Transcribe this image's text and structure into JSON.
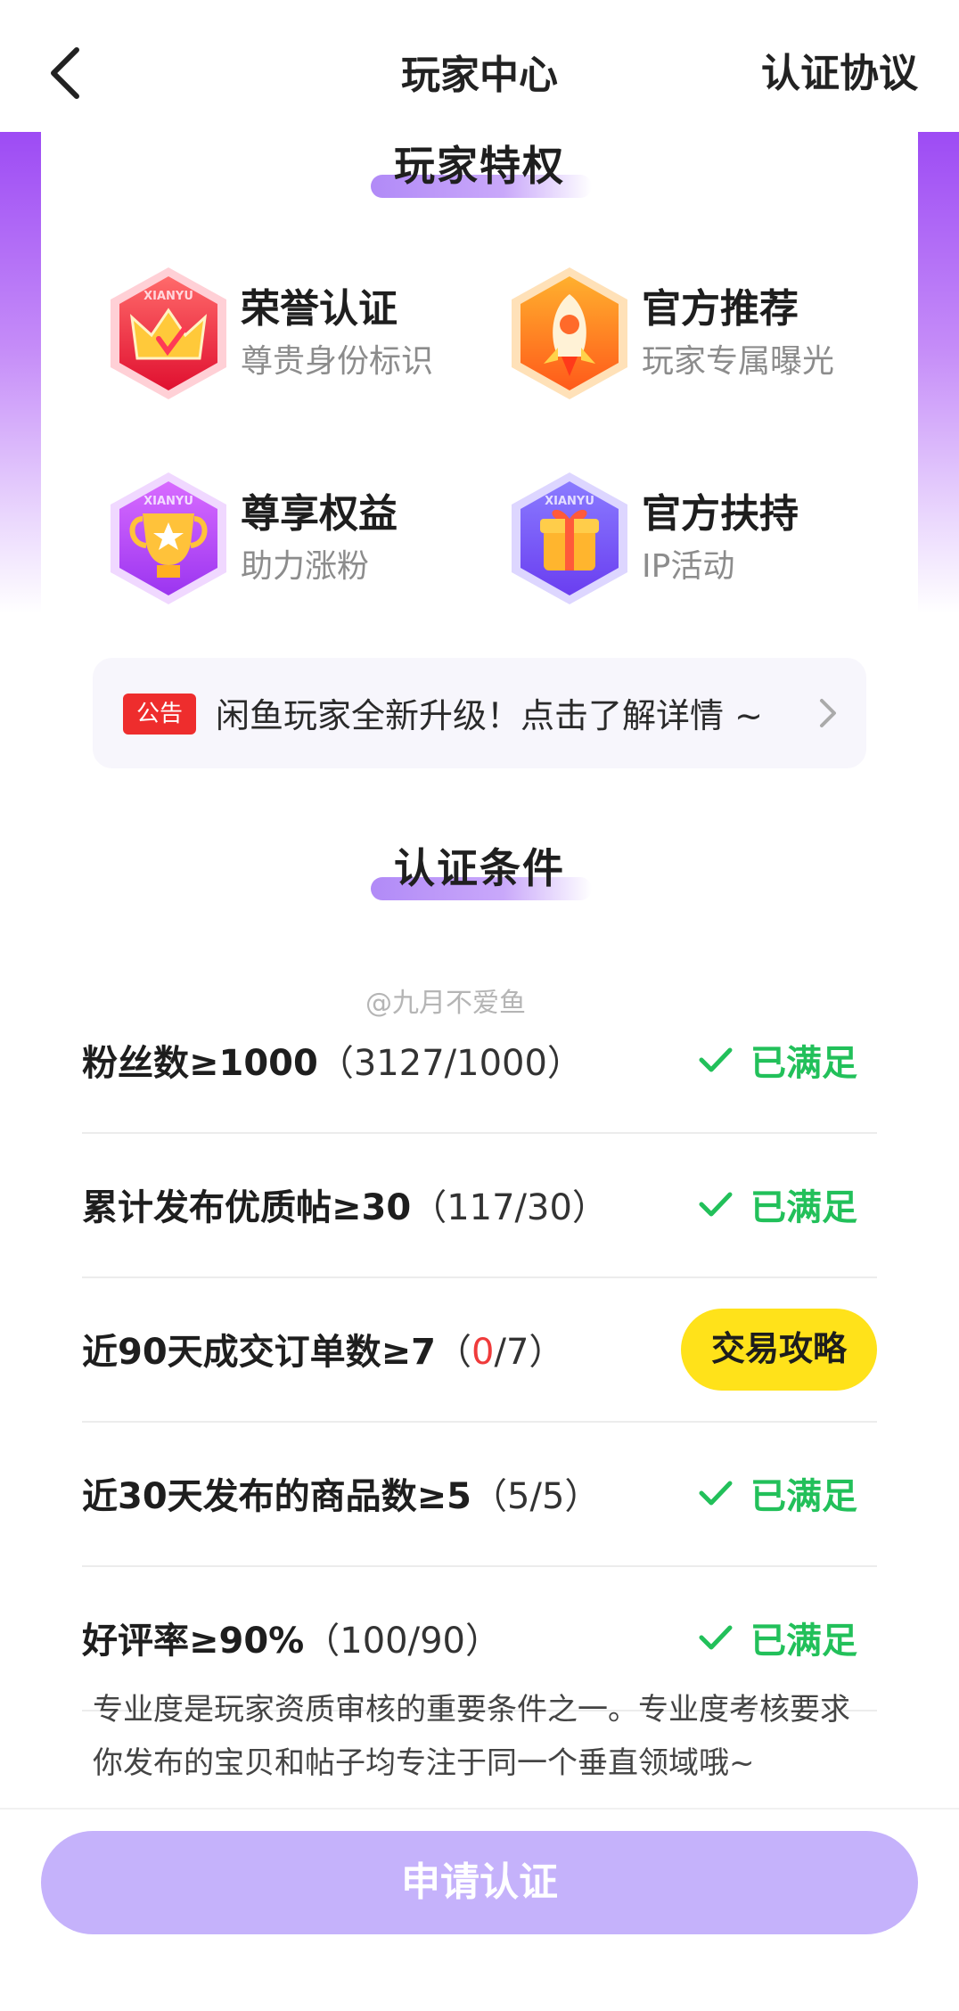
{
  "header": {
    "title": "玩家中心",
    "agreement_label": "认证协议"
  },
  "privileges": {
    "heading": "玩家特权",
    "items": [
      {
        "title": "荣誉认证",
        "subtitle": "尊贵身份标识",
        "icon": "crown-badge-icon"
      },
      {
        "title": "官方推荐",
        "subtitle": "玩家专属曝光",
        "icon": "rocket-badge-icon"
      },
      {
        "title": "尊享权益",
        "subtitle": "助力涨粉",
        "icon": "trophy-badge-icon"
      },
      {
        "title": "官方扶持",
        "subtitle": "IP活动",
        "icon": "gift-badge-icon"
      }
    ],
    "icon_badge_text": "XIANYU"
  },
  "notice": {
    "tag": "公告",
    "message": "闲鱼玩家全新升级！点击了解详情 ~"
  },
  "conditions": {
    "heading": "认证条件",
    "items": [
      {
        "label": "粉丝数≥1000",
        "progress_open": "（",
        "current": "3127",
        "target": "/1000",
        "progress_close": "）",
        "status": "已满足"
      },
      {
        "label": "累计发布优质帖≥30",
        "progress_open": "（",
        "current": "117",
        "target": "/30",
        "progress_close": "）",
        "status": "已满足"
      },
      {
        "label": "近90天成交订单数≥7",
        "progress_open": "（",
        "current": "0",
        "target": "/7",
        "progress_close": "）",
        "action": "交易攻略"
      },
      {
        "label": "近30天发布的商品数≥5",
        "progress_open": "（",
        "current": "5",
        "target": "/5",
        "progress_close": "）",
        "status": "已满足"
      },
      {
        "label": "好评率≥90%",
        "progress_open": "（",
        "current": "100",
        "target": "/90",
        "progress_close": "）",
        "status": "已满足"
      }
    ],
    "note": "专业度是玩家资质审核的重要条件之一。专业度考核要求你发布的宝贝和帖子均专注于同一个垂直领域哦~"
  },
  "watermark": "@九月不爱鱼",
  "apply_button": "申请认证",
  "colors": {
    "accent_purple": "#9d4bf4",
    "button_disabled": "#c5b2fb",
    "satisfied_green": "#22c05a",
    "yellow_button": "#ffe21a",
    "notice_red": "#ee2d2d"
  }
}
